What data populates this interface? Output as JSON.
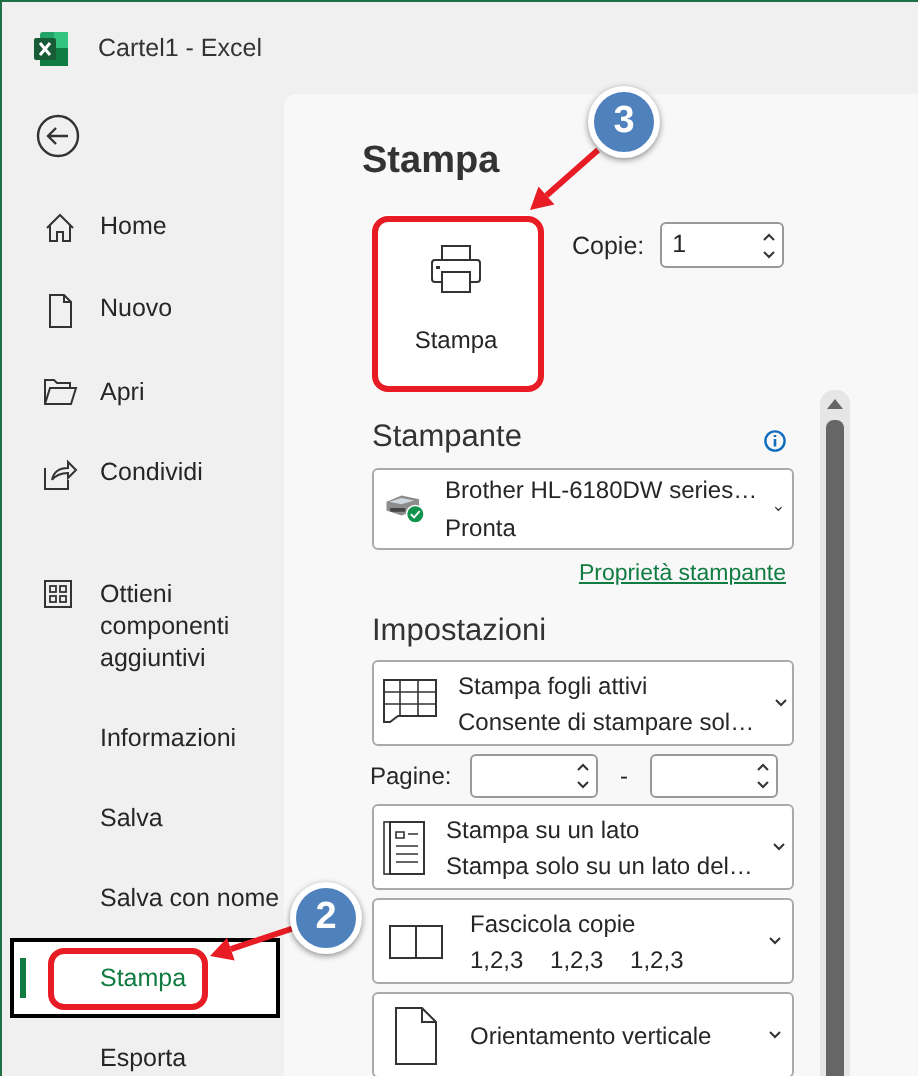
{
  "window": {
    "title": "Cartel1  -  Excel"
  },
  "nav": {
    "top_items": [
      {
        "label": "Home",
        "selected": false
      },
      {
        "label": "Nuovo",
        "selected": false
      },
      {
        "label": "Apri",
        "selected": false
      },
      {
        "label": "Condividi",
        "selected": false
      }
    ],
    "bottom_items": [
      {
        "label": "Ottieni componenti aggiuntivi",
        "selected": false
      },
      {
        "label": "Informazioni",
        "selected": false
      },
      {
        "label": "Salva",
        "selected": false
      },
      {
        "label": "Salva con nome",
        "selected": false
      },
      {
        "label": "Stampa",
        "selected": true
      },
      {
        "label": "Esporta",
        "selected": false
      }
    ]
  },
  "print": {
    "title": "Stampa",
    "button": "Stampa",
    "copies_label": "Copie:",
    "copies": "1"
  },
  "printer": {
    "heading": "Stampante",
    "name": "Brother HL-6180DW series…",
    "status": "Pronta",
    "properties_link": "Proprietà stampante"
  },
  "settings": {
    "heading": "Impostazioni",
    "pages_label": "Pagine:",
    "pages_separator": "-",
    "options": [
      {
        "title": "Stampa fogli attivi",
        "detail": "Consente di stampare sol…"
      },
      {
        "title": "Stampa su un lato",
        "detail": "Stampa solo su un lato del…"
      },
      {
        "title": "Fascicola copie",
        "detail": "1,2,3    1,2,3    1,2,3"
      },
      {
        "title": "Orientamento verticale"
      }
    ]
  },
  "annotations": [
    {
      "number": "3"
    },
    {
      "number": "2"
    }
  ]
}
